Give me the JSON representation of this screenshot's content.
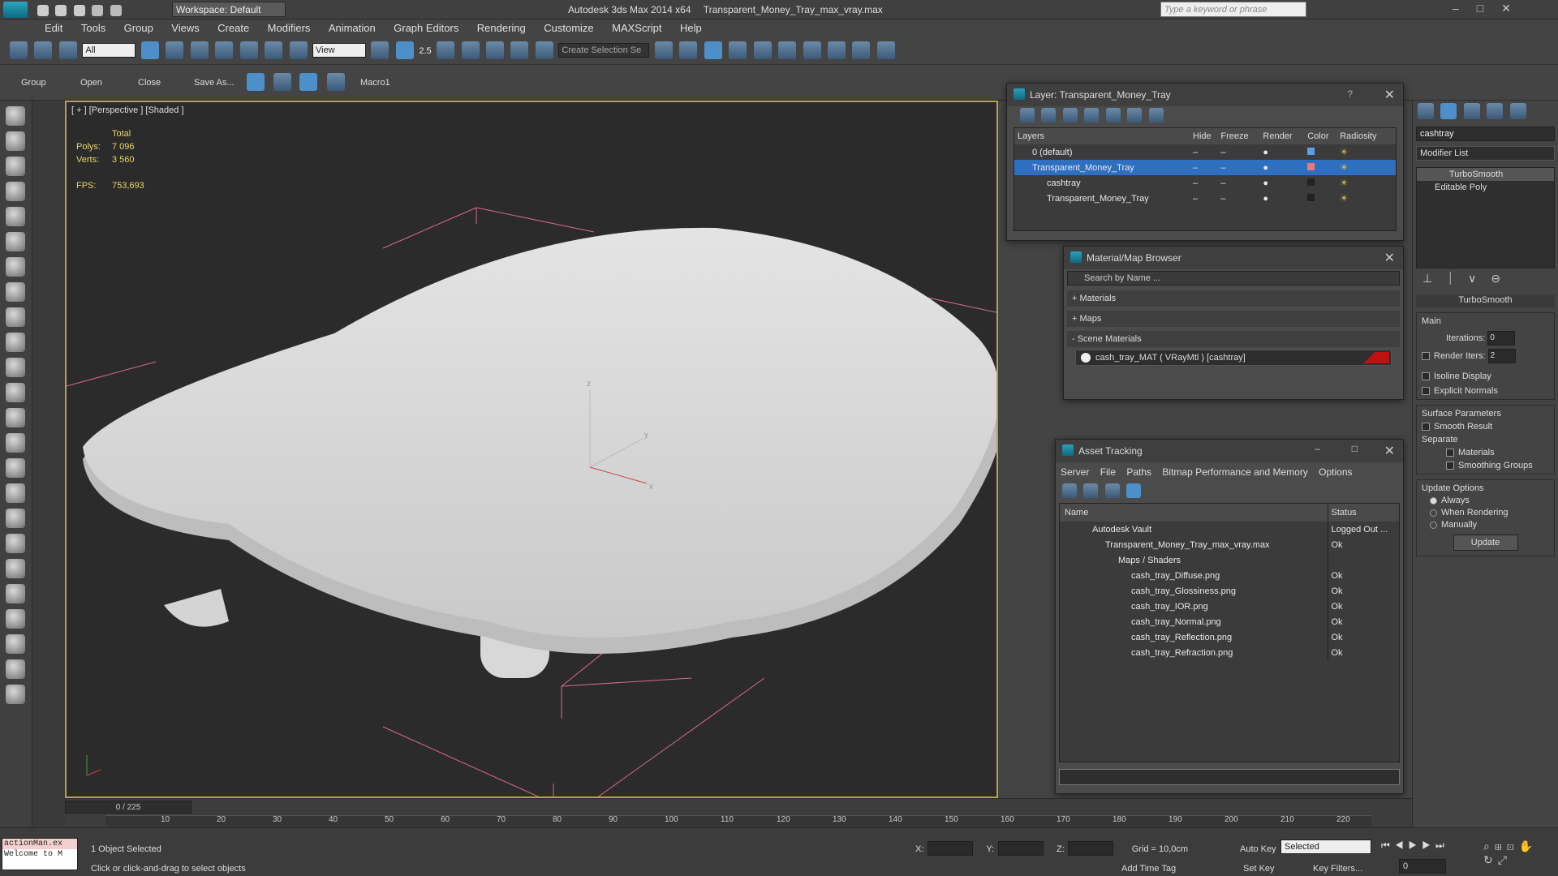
{
  "app": {
    "title": "Autodesk 3ds Max  2014 x64",
    "file": "Transparent_Money_Tray_max_vray.max",
    "workspace": "Workspace: Default",
    "search_placeholder": "Type a keyword or phrase"
  },
  "menu": [
    "Edit",
    "Tools",
    "Group",
    "Views",
    "Create",
    "Modifiers",
    "Animation",
    "Graph Editors",
    "Rendering",
    "Customize",
    "MAXScript",
    "Help"
  ],
  "toolbar": {
    "filter": "All",
    "view": "View",
    "selection_set": "Create Selection Se",
    "snap_value": "2.5"
  },
  "toolbar2": {
    "group": "Group",
    "open": "Open",
    "close": "Close",
    "save_as": "Save As...",
    "macro": "Macro1"
  },
  "viewport": {
    "label": "[ + ] [Perspective ] [Shaded ]",
    "total_label": "Total",
    "polys_label": "Polys:",
    "polys": "7 096",
    "verts_label": "Verts:",
    "verts": "3 560",
    "fps_label": "FPS:",
    "fps": "753,693",
    "axis_x": "x",
    "axis_y": "y",
    "axis_z": "z"
  },
  "layer_window": {
    "title": "Layer: Transparent_Money_Tray",
    "help": "?",
    "columns": [
      "Layers",
      "Hide",
      "Freeze",
      "Render",
      "Color",
      "Radiosity"
    ],
    "rows": [
      {
        "name": "0 (default)",
        "color": "#5aa0e8"
      },
      {
        "name": "Transparent_Money_Tray",
        "color": "#e87a7a"
      },
      {
        "name": "cashtray",
        "color": "#222222"
      },
      {
        "name": "Transparent_Money_Tray",
        "color": "#222222"
      }
    ]
  },
  "material_browser": {
    "title": "Material/Map Browser",
    "search_placeholder": "Search by Name ...",
    "groups": [
      "+ Materials",
      "+ Maps",
      "- Scene Materials"
    ],
    "item": "cash_tray_MAT  ( VRayMtl ) [cashtray]"
  },
  "asset_tracking": {
    "title": "Asset Tracking",
    "menu": [
      "Server",
      "File",
      "Paths",
      "Bitmap Performance and Memory",
      "Options"
    ],
    "columns": [
      "Name",
      "Status"
    ],
    "rows": [
      {
        "name": "Autodesk Vault",
        "status": "Logged Out ..."
      },
      {
        "name": "Transparent_Money_Tray_max_vray.max",
        "status": "Ok"
      },
      {
        "name": "Maps / Shaders",
        "status": ""
      },
      {
        "name": "cash_tray_Diffuse.png",
        "status": "Ok"
      },
      {
        "name": "cash_tray_Glossiness.png",
        "status": "Ok"
      },
      {
        "name": "cash_tray_IOR.png",
        "status": "Ok"
      },
      {
        "name": "cash_tray_Normal.png",
        "status": "Ok"
      },
      {
        "name": "cash_tray_Reflection.png",
        "status": "Ok"
      },
      {
        "name": "cash_tray_Refraction.png",
        "status": "Ok"
      }
    ]
  },
  "command_panel": {
    "object_name": "cashtray",
    "modifier_list": "Modifier List",
    "stack": [
      "TurboSmooth",
      "Editable Poly"
    ],
    "rollout_title": "TurboSmooth",
    "main": "Main",
    "iterations_label": "Iterations:",
    "iterations": "0",
    "render_iters_label": "Render Iters:",
    "render_iters": "2",
    "isoline": "Isoline Display",
    "explicit": "Explicit Normals",
    "surface": "Surface Parameters",
    "smooth_result": "Smooth Result",
    "separate": "Separate",
    "materials": "Materials",
    "smoothing_groups": "Smoothing Groups",
    "update_options": "Update Options",
    "always": "Always",
    "when_rendering": "When Rendering",
    "manually": "Manually",
    "update": "Update"
  },
  "timeline": {
    "frame": "0 / 225",
    "ticks": [
      "10",
      "20",
      "30",
      "40",
      "50",
      "60",
      "70",
      "80",
      "90",
      "100",
      "110",
      "120",
      "130",
      "140",
      "150",
      "160",
      "170",
      "180",
      "190",
      "200",
      "210",
      "220"
    ]
  },
  "status": {
    "script1": "actionMan.ex",
    "script2": "Welcome to M",
    "selected": "1 Object Selected",
    "prompt": "Click or click-and-drag to select objects",
    "x": "X:",
    "y": "Y:",
    "z": "Z:",
    "grid": "Grid = 10,0cm",
    "auto_key": "Auto Key",
    "set_key": "Set Key",
    "key_mode": "Selected",
    "key_filters": "Key Filters...",
    "add_time_tag": "Add Time Tag",
    "frame_field": "0"
  }
}
